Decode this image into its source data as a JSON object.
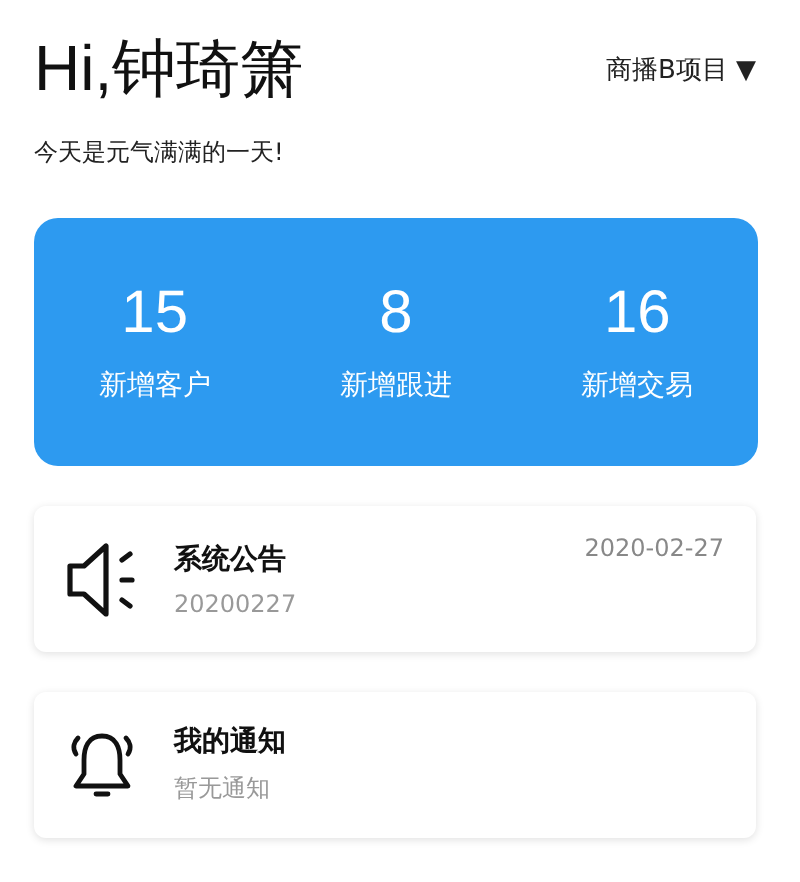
{
  "greeting": "Hi,钟琦箫",
  "project_selector": {
    "label": "商播B项目",
    "arrow": "▼"
  },
  "subtitle": "今天是元气满满的一天!",
  "stats": [
    {
      "value": "15",
      "label": "新增客户"
    },
    {
      "value": "8",
      "label": "新增跟进"
    },
    {
      "value": "16",
      "label": "新增交易"
    }
  ],
  "messages": [
    {
      "kind": "announcement",
      "title": "系统公告",
      "detail": "20200227",
      "date": "2020-02-27"
    },
    {
      "kind": "notification",
      "title": "我的通知",
      "detail": "暂无通知"
    }
  ]
}
